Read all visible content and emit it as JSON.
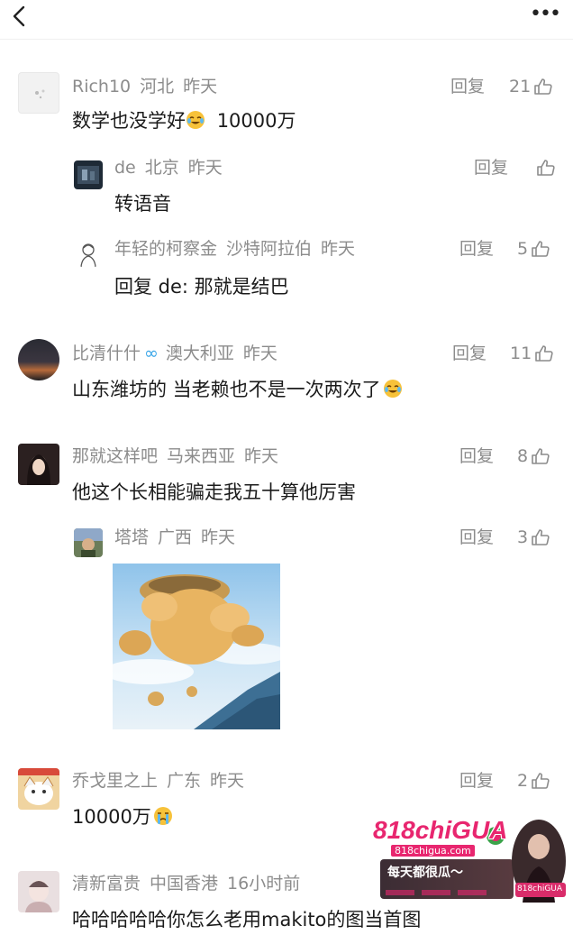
{
  "header": {
    "back_icon": "chevron-left-icon",
    "more_icon": "more-dots-icon",
    "more_glyph": "•••"
  },
  "labels": {
    "reply": "回复"
  },
  "comments": [
    {
      "user": "Rich10",
      "location": "河北",
      "time": "昨天",
      "likes": "21",
      "text_a": "数学也没学好",
      "emoji_a": "crying-laughing-emoji",
      "text_b": "10000万"
    },
    {
      "user": "de",
      "location": "北京",
      "time": "昨天",
      "likes": "",
      "text": "转语音"
    },
    {
      "user": "年轻的柯察金",
      "location": "沙特阿拉伯",
      "time": "昨天",
      "likes": "5",
      "text": "回复 de: 那就是结巴"
    },
    {
      "user": "比清什什",
      "vip": "∞",
      "location": "澳大利亚",
      "time": "昨天",
      "likes": "11",
      "text": "山东潍坊的 当老赖也不是一次两次了",
      "emoji": "crying-laughing-emoji"
    },
    {
      "user": "那就这样吧",
      "location": "马来西亚",
      "time": "昨天",
      "likes": "8",
      "text": "他这个长相能骗走我五十算他厉害"
    },
    {
      "user": "塔塔",
      "location": "广西",
      "time": "昨天",
      "likes": "3",
      "sticker": "flying-bear-sticker"
    },
    {
      "user": "乔戈里之上",
      "location": "广东",
      "time": "昨天",
      "likes": "2",
      "text": "10000万",
      "emoji": "crying-emoji"
    },
    {
      "user": "清新富贵",
      "location": "中国香港",
      "time": "16小时前",
      "likes": "",
      "text": "哈哈哈哈哈你怎么老用makito的图当首图"
    }
  ],
  "watermark": {
    "brand": "818chiGUA",
    "site": "818chigua.com",
    "slogan": "每天都很瓜～",
    "badge": "818chiGUA"
  },
  "colors": {
    "meta": "#8c8c8c",
    "text": "#1b1b1b",
    "vip": "#3aa6e8",
    "watermark_pink": "#e8266f"
  }
}
